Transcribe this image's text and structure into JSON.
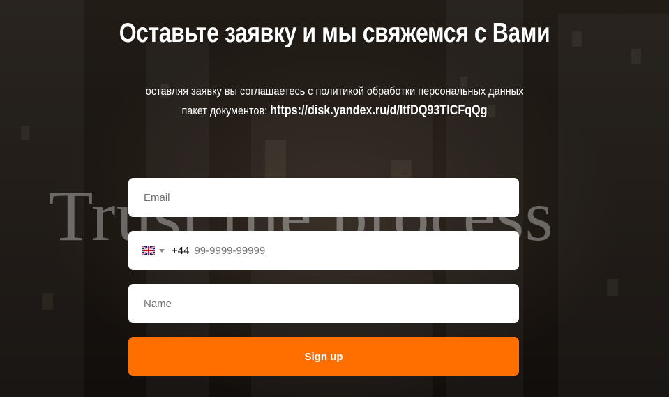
{
  "background": {
    "overlay_text": "Trust the process"
  },
  "header": {
    "title": "Оставьте заявку и мы свяжемся с Вами",
    "consent_text": "оставляя заявку вы соглашаетесь с политикой обработки персональных данных",
    "documents_label": "пакет документов: ",
    "documents_link": "https://disk.yandex.ru/d/ltfDQ93TICFqQg"
  },
  "form": {
    "email_placeholder": "Email",
    "phone": {
      "country_icon": "uk-flag-icon",
      "dial_code": "+44",
      "placeholder": "99-9999-99999"
    },
    "name_placeholder": "Name",
    "submit_label": "Sign up"
  },
  "colors": {
    "accent": "#ff6f00",
    "field_background": "#ffffff",
    "text": "#ffffff"
  }
}
